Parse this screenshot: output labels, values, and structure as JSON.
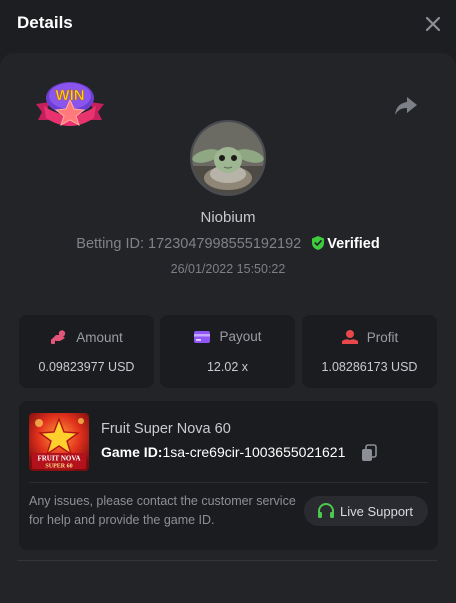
{
  "header": {
    "title": "Details"
  },
  "badge": {
    "text": "WIN"
  },
  "player": {
    "name": "Niobium",
    "betting_id_label": "Betting ID:",
    "betting_id": "1723047998555192192",
    "verified_label": "Verified",
    "timestamp": "26/01/2022 15:50:22"
  },
  "stats": [
    {
      "label": "Amount",
      "value": "0.09823977 USD",
      "icon": "coins-icon"
    },
    {
      "label": "Payout",
      "value": "12.02 x",
      "icon": "card-icon"
    },
    {
      "label": "Profit",
      "value": "1.08286173 USD",
      "icon": "profit-icon"
    }
  ],
  "game": {
    "name": "Fruit Super Nova 60",
    "id_label": "Game ID:",
    "id": "1sa-cre69cir-1003655021621",
    "thumb_text_1": "FRUIT NOVA",
    "thumb_text_2": "SUPER 60"
  },
  "support": {
    "text": "Any issues, please contact the customer service for help and provide the game ID.",
    "button_label": "Live Support"
  },
  "colors": {
    "background": "#1d1e22",
    "panel": "#232428",
    "card": "#1b1c20",
    "verified_green": "#3ecb3e",
    "amount_icon": "#e4557a",
    "payout_icon": "#8f55f5",
    "profit_icon": "#e8484b",
    "support_icon": "#4cc84c"
  }
}
